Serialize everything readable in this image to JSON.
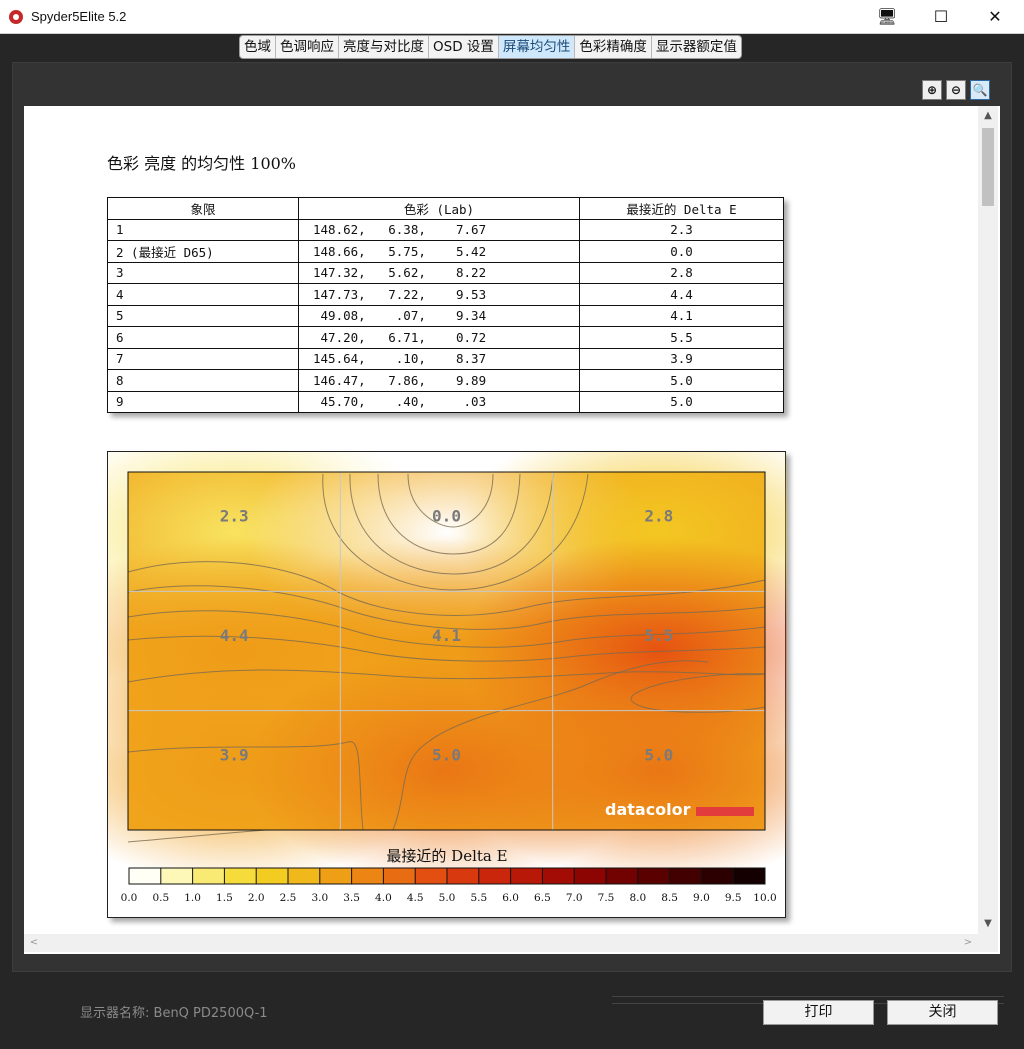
{
  "window": {
    "title": "Spyder5Elite 5.2",
    "controls": {
      "monitor_icon": "🖥",
      "maximize_icon": "☐",
      "close_icon": "✕"
    }
  },
  "tabs": [
    {
      "label": "色域",
      "active": false
    },
    {
      "label": "色调响应",
      "active": false
    },
    {
      "label": "亮度与对比度",
      "active": false
    },
    {
      "label": "OSD 设置",
      "active": false
    },
    {
      "label": "屏幕均匀性",
      "active": true
    },
    {
      "label": "色彩精确度",
      "active": false
    },
    {
      "label": "显示器额定值",
      "active": false
    }
  ],
  "zoom_tools": {
    "zoom_in": "⊕",
    "zoom_out": "⊖",
    "zoom_fit": "🔍"
  },
  "report": {
    "title": "色彩 亮度 的均匀性 100%",
    "table": {
      "headers": [
        "象限",
        "色彩 (Lab)",
        "最接近的 Delta E"
      ],
      "rows": [
        {
          "quadrant": "1",
          "lab": "148.62,   6.38,    7.67",
          "delta_e": "2.3"
        },
        {
          "quadrant": "2 (最接近 D65)",
          "lab": "148.66,   5.75,    5.42",
          "delta_e": "0.0"
        },
        {
          "quadrant": "3",
          "lab": "147.32,   5.62,    8.22",
          "delta_e": "2.8"
        },
        {
          "quadrant": "4",
          "lab": "147.73,   7.22,    9.53",
          "delta_e": "4.4"
        },
        {
          "quadrant": "5",
          "lab": " 49.08,    .07,    9.34",
          "delta_e": "4.1"
        },
        {
          "quadrant": "6",
          "lab": " 47.20,   6.71,    0.72",
          "delta_e": "5.5"
        },
        {
          "quadrant": "7",
          "lab": "145.64,    .10,    8.37",
          "delta_e": "3.9"
        },
        {
          "quadrant": "8",
          "lab": "146.47,   7.86,    9.89",
          "delta_e": "5.0"
        },
        {
          "quadrant": "9",
          "lab": " 45.70,    .40,     .03",
          "delta_e": "5.0"
        }
      ]
    }
  },
  "chart_data": {
    "type": "heatmap",
    "grid": [
      [
        "2.3",
        "0.0",
        "2.8"
      ],
      [
        "4.4",
        "4.1",
        "5.5"
      ],
      [
        "3.9",
        "5.0",
        "5.0"
      ]
    ],
    "values": [
      [
        2.3,
        0.0,
        2.8
      ],
      [
        4.4,
        4.1,
        5.5
      ],
      [
        3.9,
        5.0,
        5.0
      ]
    ],
    "legend_title": "最接近的 Delta E",
    "scale_ticks": [
      "0.0",
      "0.5",
      "1.0",
      "1.5",
      "2.0",
      "2.5",
      "3.0",
      "3.5",
      "4.0",
      "4.5",
      "5.0",
      "5.5",
      "6.0",
      "6.5",
      "7.0",
      "7.5",
      "8.0",
      "8.5",
      "9.0",
      "9.5",
      "10.0"
    ],
    "scale_range": [
      0,
      10
    ],
    "watermark": "datacolor",
    "colors": [
      "#fffff5",
      "#fdf7b8",
      "#f9ea73",
      "#f6dc3a",
      "#f3cc22",
      "#f1b81b",
      "#ef9f16",
      "#ec8514",
      "#e86c12",
      "#e24f10",
      "#d9390e",
      "#c9260b",
      "#b81808",
      "#a20c05",
      "#8c0503",
      "#720201",
      "#5a0000",
      "#430000",
      "#2c0000",
      "#140000"
    ]
  },
  "footer": {
    "display_label": "显示器名称:",
    "display_value": "BenQ PD2500Q-1",
    "print_label": "打印",
    "close_label": "关闭"
  },
  "scroll": {
    "up": "▲",
    "down": "▼",
    "left": "<",
    "right": ">"
  }
}
